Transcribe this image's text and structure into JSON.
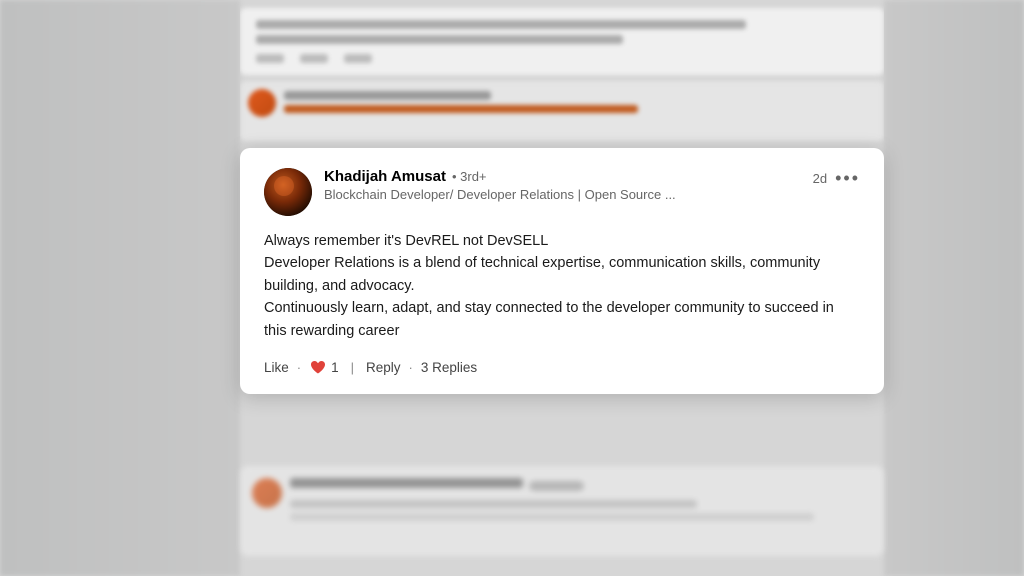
{
  "page": {
    "background_color": "#c8c8c8"
  },
  "card": {
    "user": {
      "name": "Khadijah Amusat",
      "degree": "• 3rd+",
      "title": "Blockchain Developer/ Developer Relations | Open Source ..."
    },
    "timestamp": "2d",
    "more_label": "•••",
    "content": "Always remember it's DevREL not DevSELL\nDeveloper Relations is a blend of technical expertise, communication skills, community building, and advocacy.\nContinuously learn, adapt, and stay connected to the developer community to succeed in this rewarding career",
    "actions": {
      "like_label": "Like",
      "like_count": "1",
      "reply_label": "Reply",
      "replies_count": "3 Replies"
    }
  }
}
